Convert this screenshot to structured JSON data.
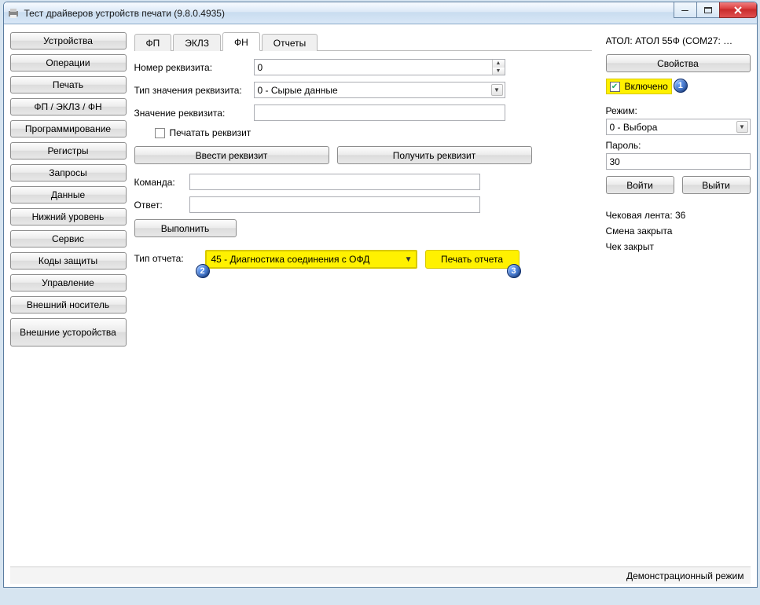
{
  "window": {
    "title": "Тест драйверов устройств печати (9.8.0.4935)",
    "icon_name": "printer-icon",
    "min": "—",
    "max": "▢",
    "close": "✕"
  },
  "nav": {
    "items": [
      "Устройства",
      "Операции",
      "Печать",
      "ФП / ЭКЛЗ / ФН",
      "Программирование",
      "Регистры",
      "Запросы",
      "Данные",
      "Нижний уровень",
      "Сервис",
      "Коды защиты",
      "Управление",
      "Внешний носитель",
      "Внешние усторойства"
    ]
  },
  "tabs": {
    "items": [
      "ФП",
      "ЭКЛЗ",
      "ФН",
      "Отчеты"
    ],
    "active_index": 2
  },
  "main": {
    "req_num_label": "Номер реквизита:",
    "req_num_value": "0",
    "req_type_label": "Тип значения реквизита:",
    "req_type_value": "0 - Сырые данные",
    "req_val_label": "Значение реквизита:",
    "req_val_value": "",
    "print_req_checkbox": "Печатать реквизит",
    "print_req_checked": false,
    "btn_enter": "Ввести реквизит",
    "btn_get": "Получить реквизит",
    "cmd_label": "Команда:",
    "cmd_value": "",
    "ans_label": "Ответ:",
    "ans_value": "",
    "btn_exec": "Выполнить",
    "report_type_label": "Тип отчета:",
    "report_type_value": "45 - Диагностика соединения с ОФД",
    "btn_print_report": "Печать отчета"
  },
  "right": {
    "device": "АТОЛ: АТОЛ 55Ф (COM27: …",
    "btn_props": "Свойства",
    "enabled_label": "Включено",
    "enabled_checked": true,
    "mode_label": "Режим:",
    "mode_value": "0 - Выбора",
    "password_label": "Пароль:",
    "password_value": "30",
    "btn_login": "Войти",
    "btn_logout": "Выйти",
    "tape": "Чековая лента: 36",
    "shift": "Смена закрыта",
    "receipt": "Чек закрыт"
  },
  "badges": {
    "b1": "1",
    "b2": "2",
    "b3": "3"
  },
  "status": {
    "text": "Демонстрационный режим"
  }
}
